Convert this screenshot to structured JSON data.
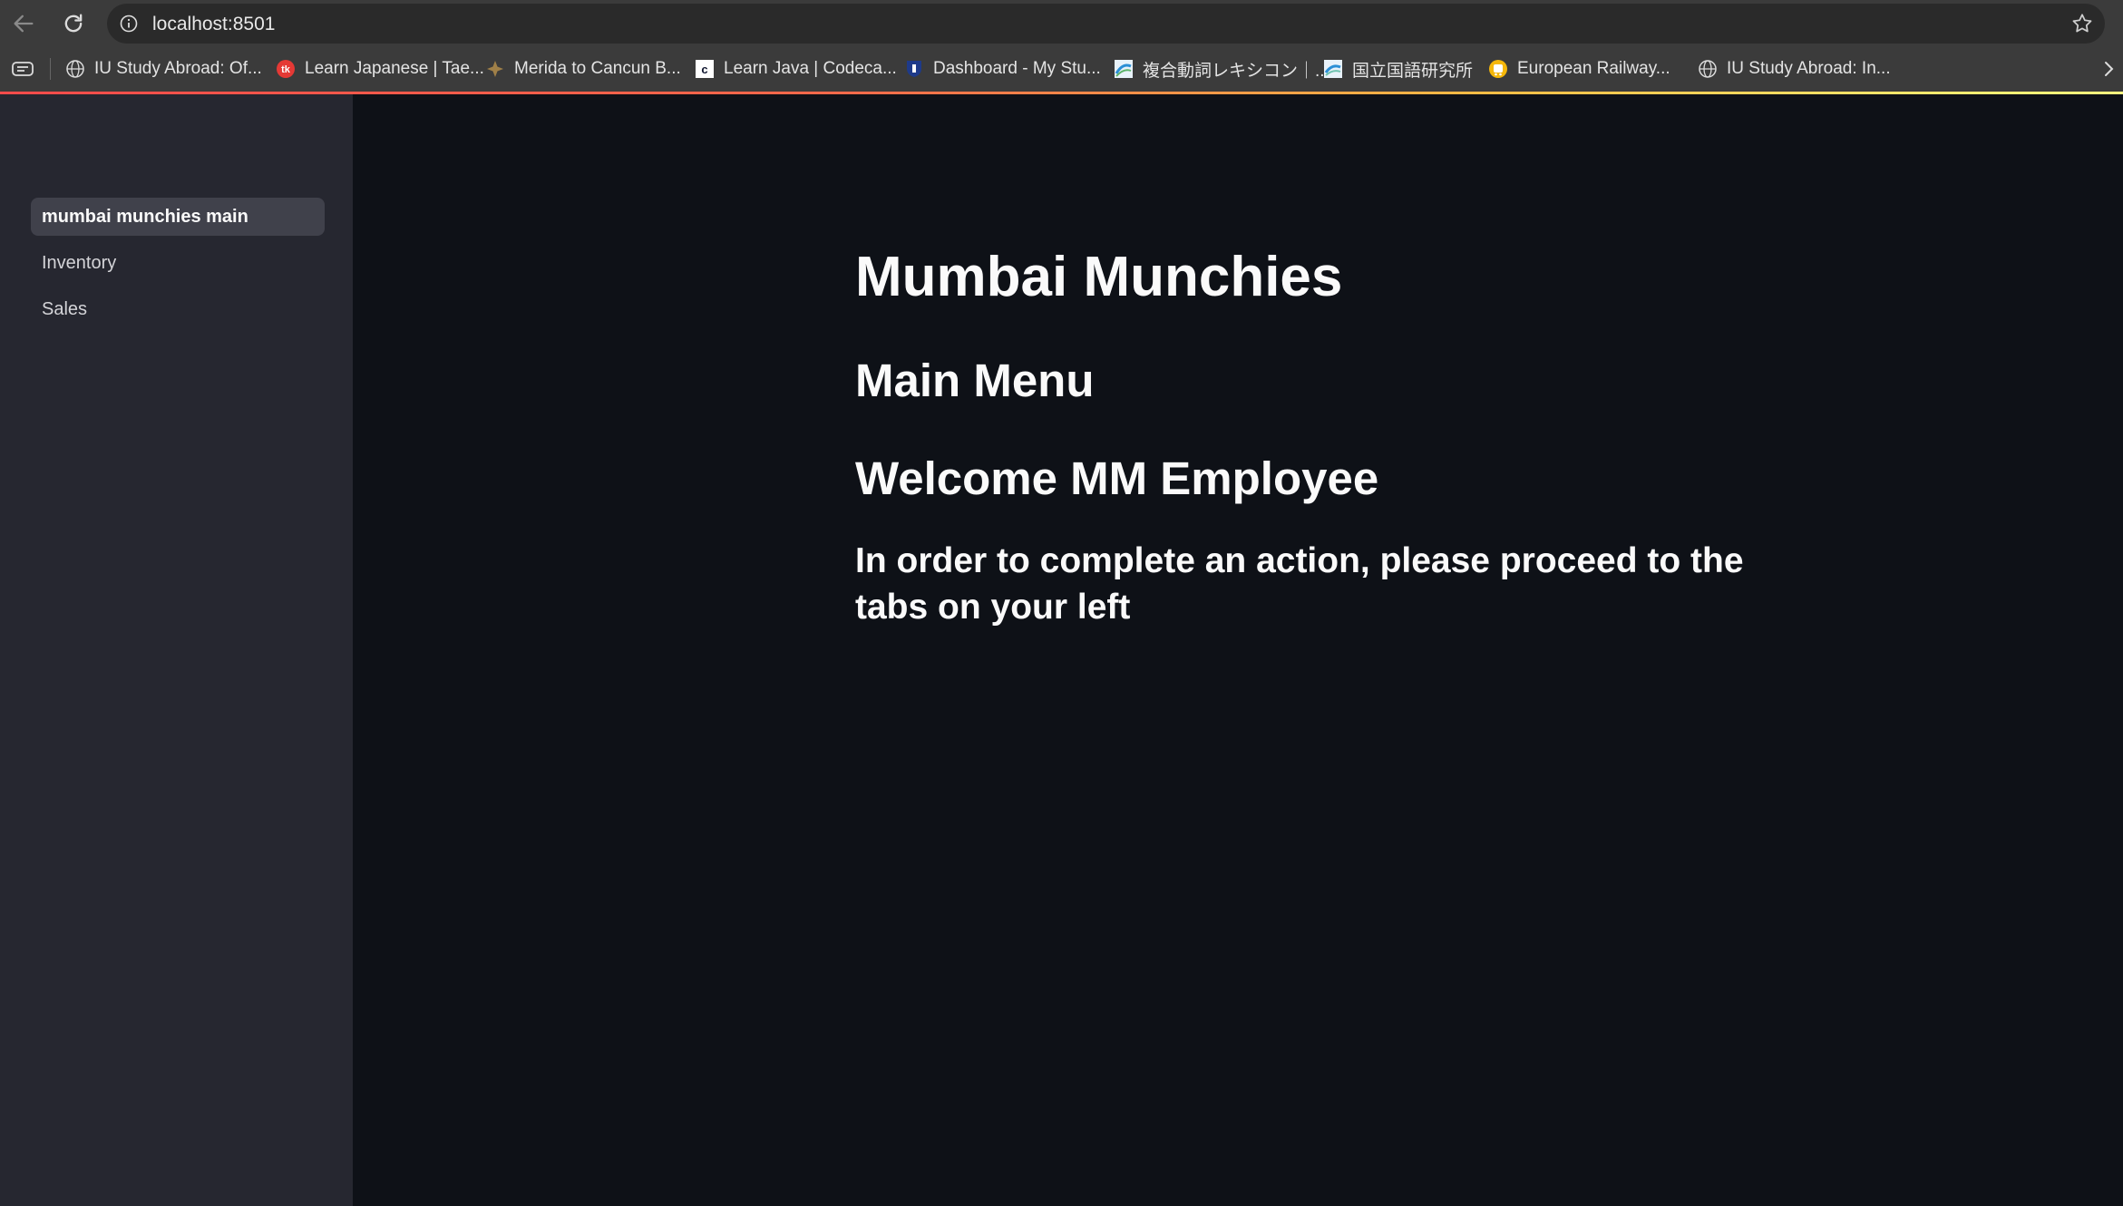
{
  "browser": {
    "url": "localhost:8501",
    "bookmarks": [
      {
        "label": "IU Study Abroad: Of...",
        "icon": "globe-icon"
      },
      {
        "label": "Learn Japanese | Tae...",
        "icon": "tk-logo-icon"
      },
      {
        "label": "Merida to Cancun B...",
        "icon": "compass-icon"
      },
      {
        "label": "Learn Java | Codeca...",
        "icon": "codecademy-icon"
      },
      {
        "label": "Dashboard - My Stu...",
        "icon": "shield-icon"
      },
      {
        "label": "複合動詞レキシコン｜...",
        "icon": "lexicon-icon"
      },
      {
        "label": "国立国語研究所",
        "icon": "ninjal-icon"
      },
      {
        "label": "European Railway...",
        "icon": "railway-icon"
      },
      {
        "label": "IU Study Abroad: In...",
        "icon": "globe-icon"
      }
    ]
  },
  "sidebar": {
    "items": [
      {
        "label": "mumbai munchies main",
        "active": true
      },
      {
        "label": "Inventory",
        "active": false
      },
      {
        "label": "Sales",
        "active": false
      }
    ]
  },
  "main": {
    "title": "Mumbai Munchies",
    "subtitle": "Main Menu",
    "welcome": "Welcome MM Employee",
    "instruction": "In order to complete an action, please proceed to the tabs on your left"
  },
  "colors": {
    "sidebar_bg": "#262730",
    "main_bg": "#0e1117",
    "text": "#fafafa",
    "accent": "#ff4b4b"
  }
}
